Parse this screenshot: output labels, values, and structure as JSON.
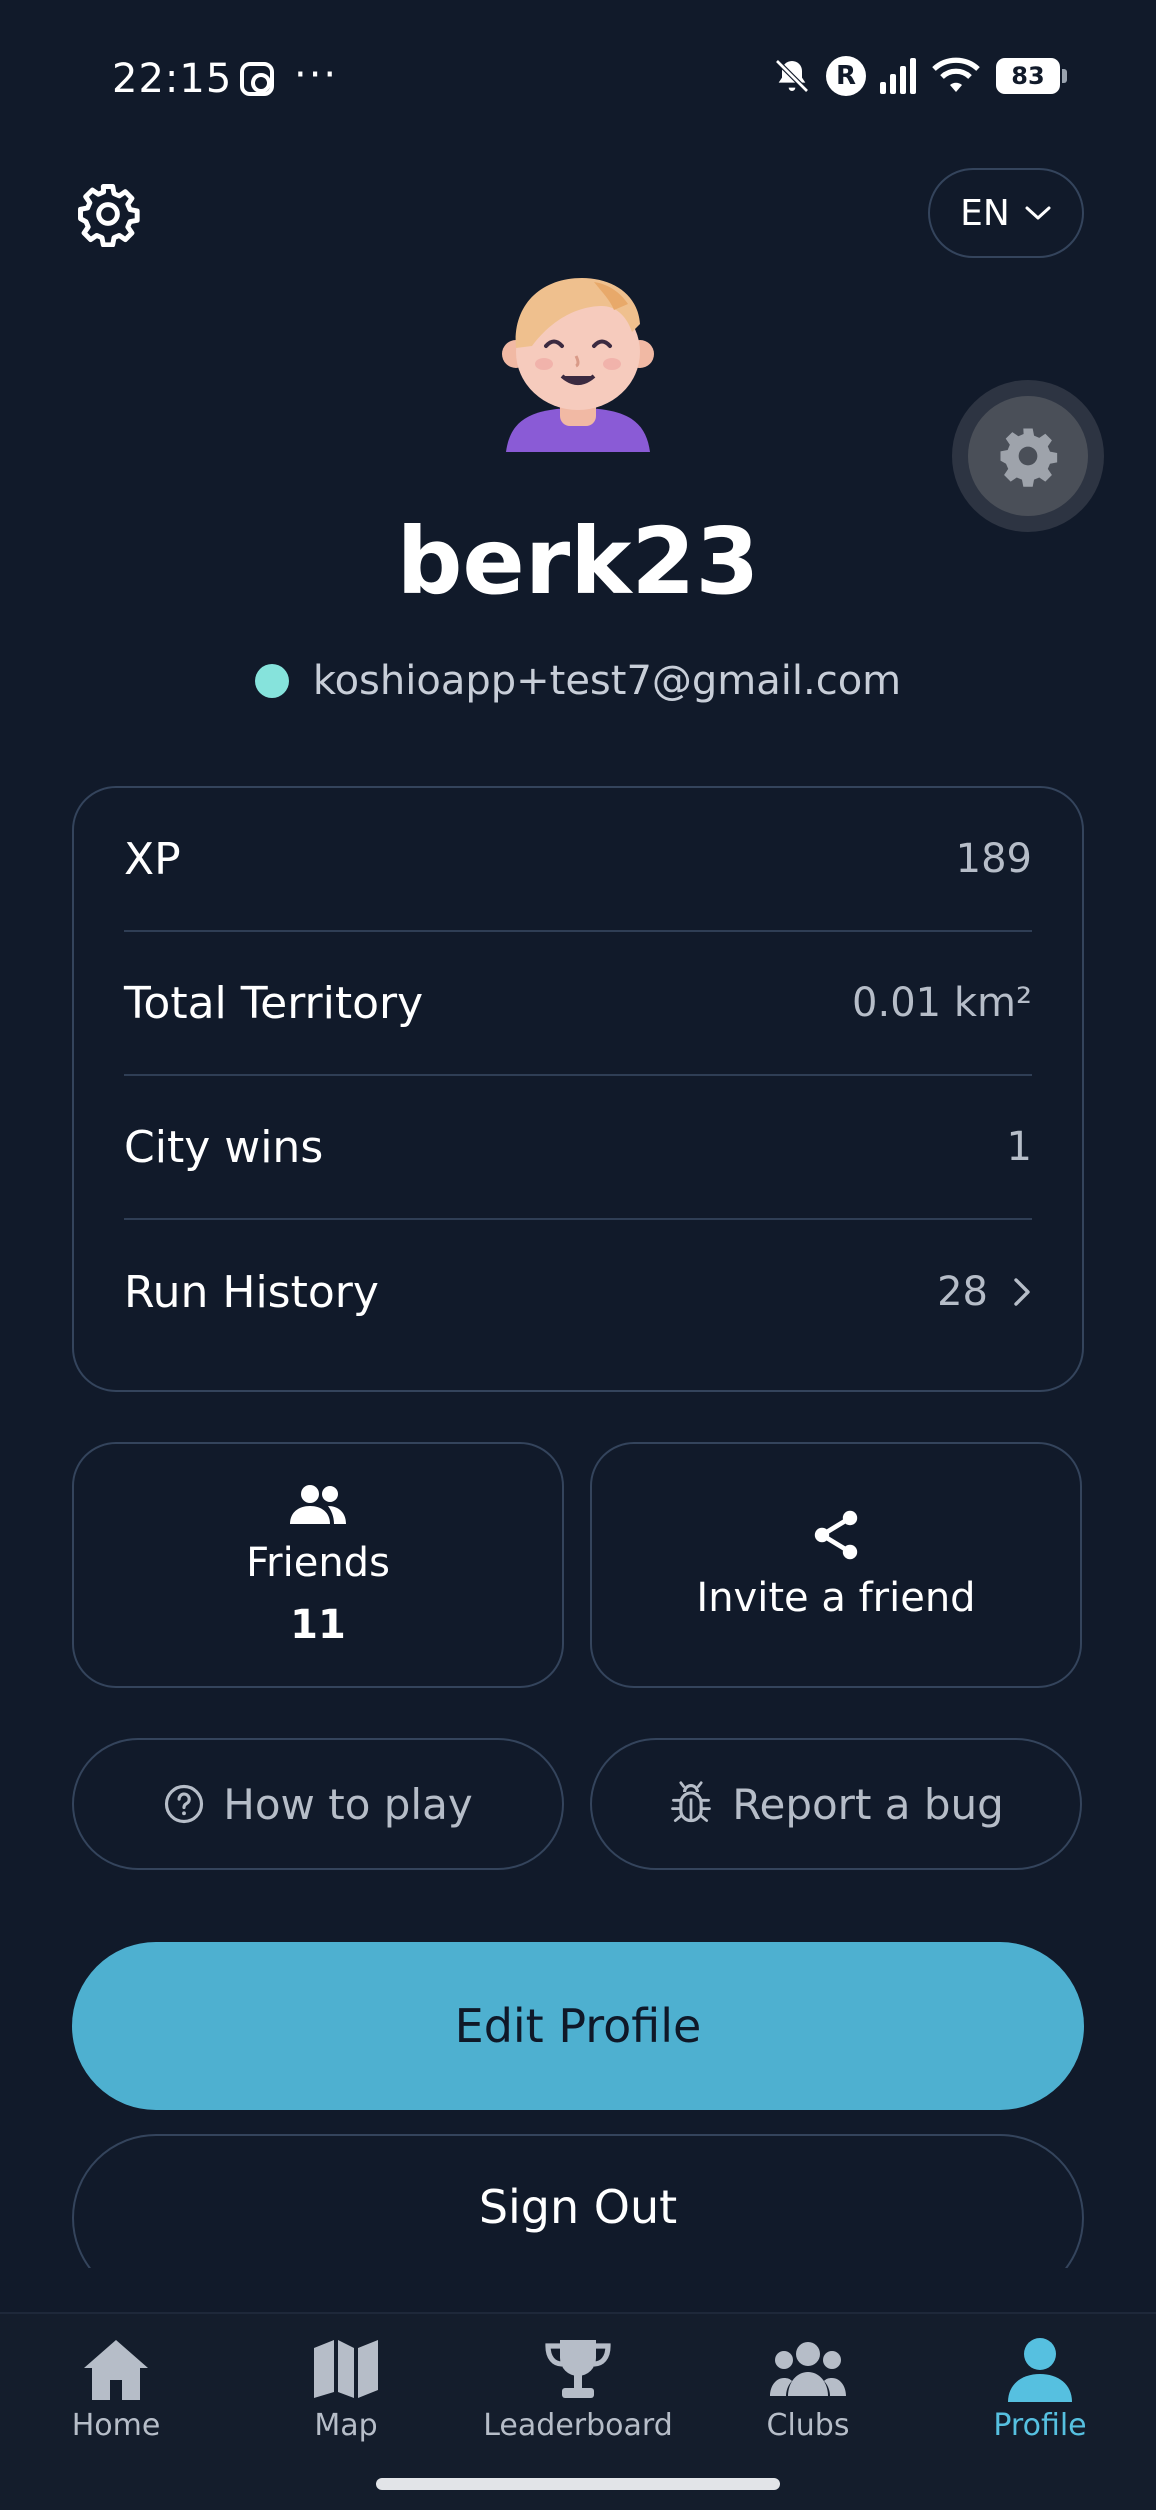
{
  "status_bar": {
    "time": "22:15",
    "more": "···",
    "battery": "83",
    "r_badge": "R",
    "icons": [
      "instagram-icon",
      "bell-off-icon",
      "signal-icon",
      "wifi-icon",
      "battery-icon"
    ]
  },
  "header": {
    "language": "EN",
    "settings_icon": "gear-icon"
  },
  "profile": {
    "username": "berk23",
    "email": "koshioapp+test7@gmail.com",
    "status_color": "#86e3dc"
  },
  "stats": [
    {
      "label": "XP",
      "value": "189"
    },
    {
      "label": "Total Territory",
      "value": "0.01 km²"
    },
    {
      "label": "City wins",
      "value": "1"
    },
    {
      "label": "Run History",
      "value": "28"
    }
  ],
  "tiles": {
    "friends_label": "Friends",
    "friends_count": "11",
    "invite_label": "Invite a friend"
  },
  "actions": {
    "how_to_play": "How to play",
    "report_bug": "Report a bug",
    "edit_profile": "Edit Profile",
    "sign_out": "Sign Out"
  },
  "nav": [
    {
      "label": "Home",
      "icon": "home-icon"
    },
    {
      "label": "Map",
      "icon": "map-icon"
    },
    {
      "label": "Leaderboard",
      "icon": "trophy-icon"
    },
    {
      "label": "Clubs",
      "icon": "users-icon"
    },
    {
      "label": "Profile",
      "icon": "person-icon",
      "active": true
    }
  ],
  "colors": {
    "background": "#111a2a",
    "accent": "#4eb0d0",
    "nav_active": "#56c0e0",
    "border": "#34445c"
  }
}
